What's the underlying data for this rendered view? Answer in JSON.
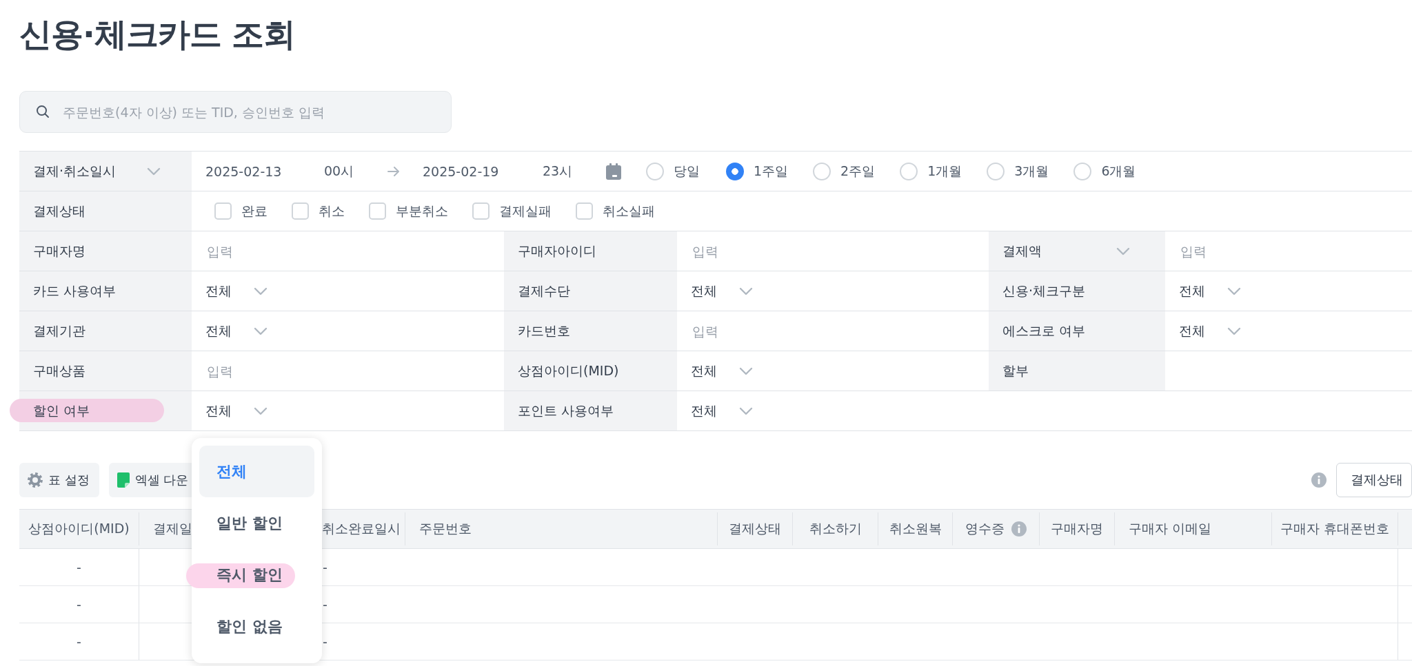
{
  "title": "신용·체크카드 조회",
  "search": {
    "placeholder": "주문번호(4자 이상) 또는 TID, 승인번호 입력"
  },
  "filters": {
    "date": {
      "label": "결제·취소일시",
      "has_dropdown": true,
      "start_date": "2025-02-13",
      "start_hour": "00시",
      "end_date": "2025-02-19",
      "end_hour": "23시",
      "periods": [
        {
          "label": "당일",
          "selected": false
        },
        {
          "label": "1주일",
          "selected": true
        },
        {
          "label": "2주일",
          "selected": false
        },
        {
          "label": "1개월",
          "selected": false
        },
        {
          "label": "3개월",
          "selected": false
        },
        {
          "label": "6개월",
          "selected": false
        }
      ]
    },
    "status": {
      "label": "결제상태",
      "options": [
        {
          "label": "완료",
          "checked": false
        },
        {
          "label": "취소",
          "checked": false
        },
        {
          "label": "부분취소",
          "checked": false
        },
        {
          "label": "결제실패",
          "checked": false
        },
        {
          "label": "취소실패",
          "checked": false
        }
      ]
    },
    "rows": [
      {
        "cells": [
          {
            "label": "구매자명",
            "has_dropdown": false,
            "highlighted": false,
            "field": {
              "kind": "input",
              "placeholder": "입력"
            }
          },
          {
            "label": "구매자아이디",
            "has_dropdown": false,
            "highlighted": false,
            "field": {
              "kind": "input",
              "placeholder": "입력"
            }
          },
          {
            "label": "결제액",
            "has_dropdown": true,
            "highlighted": false,
            "field": {
              "kind": "input",
              "placeholder": "입력"
            }
          }
        ]
      },
      {
        "cells": [
          {
            "label": "카드 사용여부",
            "has_dropdown": false,
            "highlighted": false,
            "field": {
              "kind": "select",
              "value": "전체"
            }
          },
          {
            "label": "결제수단",
            "has_dropdown": false,
            "highlighted": false,
            "field": {
              "kind": "select",
              "value": "전체"
            }
          },
          {
            "label": "신용·체크구분",
            "has_dropdown": false,
            "highlighted": false,
            "field": {
              "kind": "select",
              "value": "전체"
            }
          }
        ]
      },
      {
        "cells": [
          {
            "label": "결제기관",
            "has_dropdown": false,
            "highlighted": false,
            "field": {
              "kind": "select",
              "value": "전체"
            }
          },
          {
            "label": "카드번호",
            "has_dropdown": false,
            "highlighted": false,
            "field": {
              "kind": "input",
              "placeholder": "입력"
            }
          },
          {
            "label": "에스크로 여부",
            "has_dropdown": false,
            "highlighted": false,
            "field": {
              "kind": "select",
              "value": "전체"
            }
          }
        ]
      },
      {
        "cells": [
          {
            "label": "구매상품",
            "has_dropdown": false,
            "highlighted": false,
            "field": {
              "kind": "input",
              "placeholder": "입력"
            }
          },
          {
            "label": "상점아이디(MID)",
            "has_dropdown": false,
            "highlighted": false,
            "field": {
              "kind": "select",
              "value": "전체"
            }
          },
          {
            "label": "할부",
            "has_dropdown": false,
            "highlighted": false,
            "field": {
              "kind": "empty"
            }
          }
        ]
      },
      {
        "cells": [
          {
            "label": "할인 여부",
            "has_dropdown": false,
            "highlighted": true,
            "field": {
              "kind": "select",
              "value": "전체"
            }
          },
          {
            "label": "포인트 사용여부",
            "has_dropdown": false,
            "highlighted": false,
            "field": {
              "kind": "select",
              "value": "전체"
            }
          }
        ]
      }
    ]
  },
  "toolbar": {
    "buttons": [
      {
        "kind": "settings",
        "label": "표 설정"
      },
      {
        "kind": "excel",
        "label": "엑셀 다운"
      }
    ],
    "status_button": "결제상태"
  },
  "table": {
    "columns": [
      {
        "label": "상점아이디(MID)",
        "info": false
      },
      {
        "label": "결제일",
        "info": false
      },
      {
        "label": "취소완료일시",
        "info": false
      },
      {
        "label": "주문번호",
        "info": false
      },
      {
        "label": "결제상태",
        "info": false
      },
      {
        "label": "취소하기",
        "info": false
      },
      {
        "label": "취소원복",
        "info": false
      },
      {
        "label": "영수증",
        "info": true
      },
      {
        "label": "구매자명",
        "info": false
      },
      {
        "label": "구매자 이메일",
        "info": false
      },
      {
        "label": "구매자 휴대폰번호",
        "info": false
      }
    ],
    "rows": [
      {
        "mid": "-",
        "cancel_completed_at": "-"
      },
      {
        "mid": "-",
        "cancel_completed_at": "-"
      },
      {
        "mid": "-",
        "cancel_completed_at": "-"
      }
    ]
  },
  "dropdown": {
    "options": [
      {
        "label": "전체",
        "selected": true,
        "highlighted": false
      },
      {
        "label": "일반 할인",
        "selected": false,
        "highlighted": false
      },
      {
        "label": "즉시 할인",
        "selected": false,
        "highlighted": true
      },
      {
        "label": "할인 없음",
        "selected": false,
        "highlighted": false
      }
    ]
  }
}
